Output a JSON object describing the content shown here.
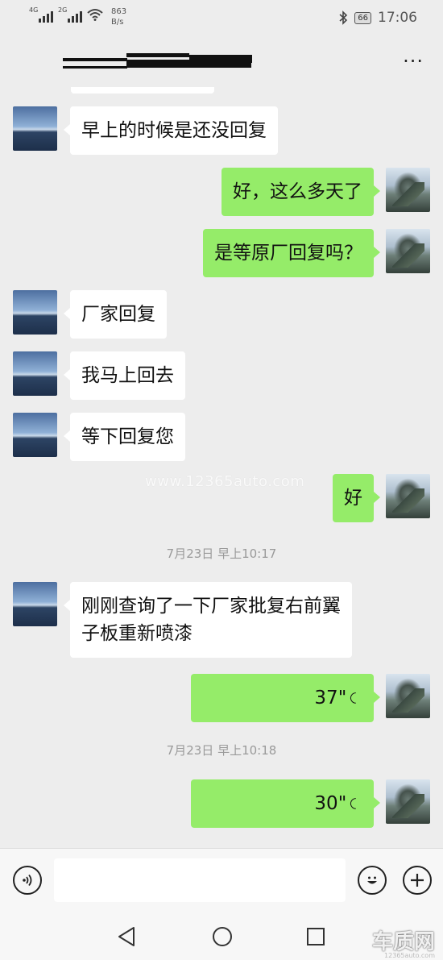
{
  "status_bar": {
    "sim1_tag": "4G",
    "sim2_tag": "2G",
    "net_speed_value": "863",
    "net_speed_unit": "B/s",
    "battery": "66",
    "time": "17:06"
  },
  "header": {
    "more_label": "···"
  },
  "messages": [
    {
      "side": "in",
      "text": "早上的时候是还没回复"
    },
    {
      "side": "out",
      "text": "好，这么多天了"
    },
    {
      "side": "out",
      "text": "是等原厂回复吗？"
    },
    {
      "side": "in",
      "text": "厂家回复"
    },
    {
      "side": "in",
      "text": "我马上回去"
    },
    {
      "side": "in",
      "text": "等下回复您"
    },
    {
      "side": "out",
      "text": "好"
    },
    {
      "side": "in",
      "line1": "刚刚查询了一下厂家批复右前翼",
      "line2": "子板重新喷漆"
    },
    {
      "side": "out",
      "voice_duration": "37\""
    },
    {
      "side": "out",
      "voice_duration": "30\""
    }
  ],
  "timestamps": [
    "7月23日 早上10:17",
    "7月23日 早上10:18"
  ],
  "watermark": "www.12365auto.com",
  "input_bar": {
    "voice_icon": "voice-icon",
    "emoji_icon": "emoji-icon",
    "plus_icon": "plus-icon"
  },
  "nav": {
    "back": "◁",
    "home": "○",
    "recent": "□"
  },
  "logo": {
    "name": "车质网",
    "url": "12365auto.com"
  },
  "colors": {
    "background": "#ededed",
    "bubble_out": "#95ec69",
    "bubble_in": "#ffffff"
  }
}
